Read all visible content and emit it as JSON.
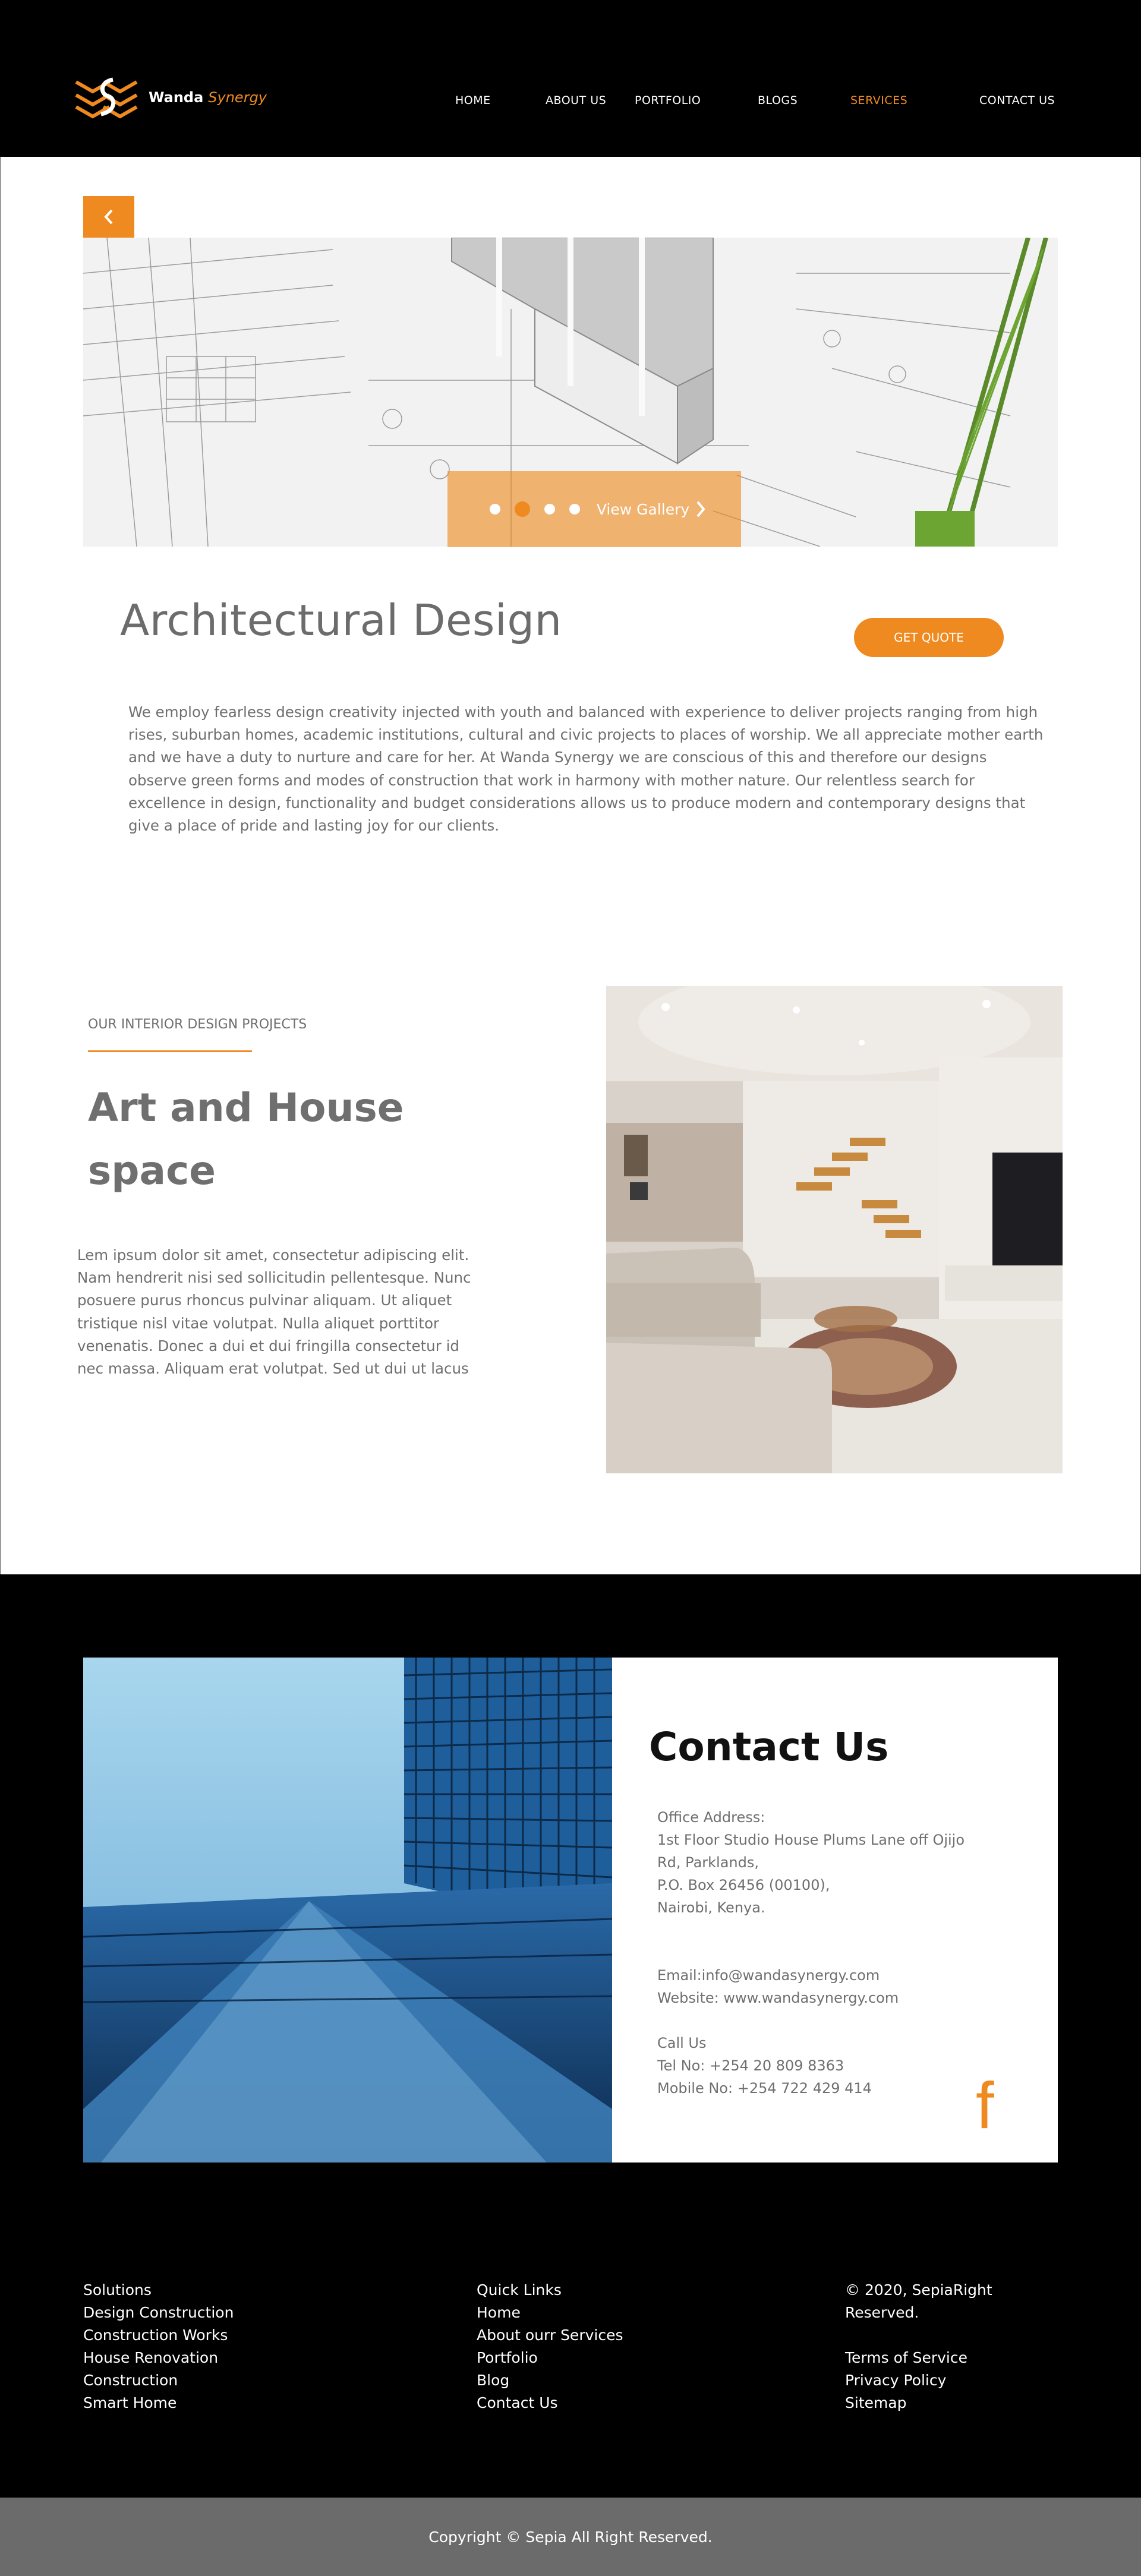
{
  "brand": {
    "name_part1": "Wanda",
    "name_part2": "Synergy",
    "accent_color": "#ee8a1f"
  },
  "nav": {
    "items": [
      {
        "label": "HOME"
      },
      {
        "label": "ABOUT US"
      },
      {
        "label": "PORTFOLIO"
      },
      {
        "label": "BLOGS"
      },
      {
        "label": "SERVICES",
        "active": true
      },
      {
        "label": "CONTACT US"
      }
    ]
  },
  "hero": {
    "back_icon": "chevron-left-icon",
    "gallery_label": "View Gallery",
    "dots_count": 4,
    "active_dot": 1
  },
  "service": {
    "title": "Architectural Design",
    "quote_button": "GET QUOTE",
    "description": "We employ fearless design creativity injected with youth and balanced with experience to deliver projects ranging from high rises, suburban homes, academic institutions, cultural and civic projects to places of worship. We all appreciate mother earth and we have a duty to nurture and care for her. At Wanda Synergy we are conscious of this and therefore our designs observe green forms and modes of construction that work in harmony with mother nature. Our relentless search for excellence in design, functionality and budget considerations allows us to produce modern and contemporary designs that give a place of pride and lasting joy for our clients."
  },
  "interior": {
    "eyebrow": "OUR INTERIOR DESIGN PROJECTS",
    "title_line1": "Art and House",
    "title_line2": "space",
    "text": "Lem ipsum dolor sit amet, consectetur adipiscing elit. Nam hendrerit nisi sed sollicitudin pellentesque. Nunc posuere purus rhoncus pulvinar aliquam. Ut aliquet tristique nisl vitae volutpat. Nulla aliquet porttitor venenatis. Donec a dui et dui fringilla consectetur id nec massa. Aliquam erat volutpat. Sed ut dui ut lacus"
  },
  "contact": {
    "title": "Contact Us",
    "address_label": "Office Address:",
    "address_line1": "1st Floor Studio House Plums Lane off Ojijo",
    "address_line2": "Rd, Parklands,",
    "address_line3": "P.O. Box 26456 (00100),",
    "address_line4": "Nairobi, Kenya.",
    "email": "Email:info@wandasynergy.com",
    "website": "Website: www.wandasynergy.com",
    "call_label": "Call Us",
    "tel": "Tel No: +254 20 809 8363",
    "mobile": "Mobile No: +254 722 429 414",
    "social_icon": "facebook-icon",
    "social_glyph": "f"
  },
  "footer": {
    "solutions": [
      "Solutions",
      "Design Construction",
      "Construction Works",
      "House Renovation",
      "Construction",
      "Smart Home"
    ],
    "quick_links": [
      "Quick Links",
      "Home",
      "About ourr Services",
      "Portfolio",
      "Blog",
      "Contact Us"
    ],
    "legal_top": [
      "© 2020, SepiaRight",
      "Reserved."
    ],
    "legal_links": [
      "Terms of Service",
      "Privacy Policy",
      "Sitemap"
    ],
    "copyright": "Copyright © Sepia All Right Reserved."
  }
}
